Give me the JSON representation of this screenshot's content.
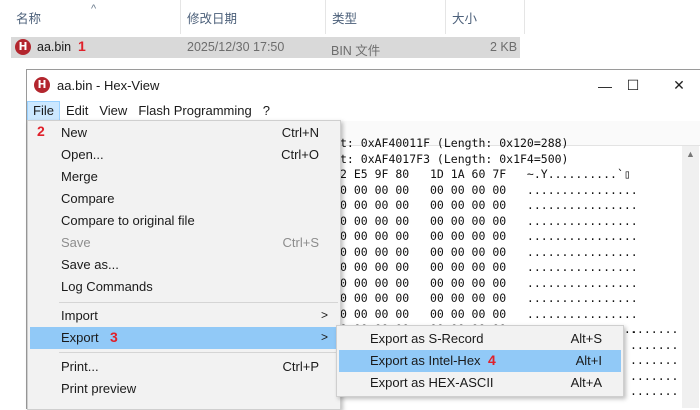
{
  "explorer": {
    "headers": {
      "name": "名称",
      "modified": "修改日期",
      "type": "类型",
      "size": "大小"
    },
    "file": {
      "icon": "hexview-file-icon",
      "name": "aa.bin",
      "step": "1",
      "date": "2025/12/30 17:50",
      "type": "BIN 文件",
      "size": "2 KB"
    }
  },
  "window": {
    "title": "aa.bin - Hex-View",
    "controls": {
      "minimize": "—",
      "maximize": "☐",
      "close": "✕"
    }
  },
  "menubar": [
    "File",
    "Edit",
    "View",
    "Flash Programming",
    "?"
  ],
  "file_menu": {
    "step": "2",
    "items": [
      {
        "label": "New",
        "shortcut": "Ctrl+N"
      },
      {
        "label": "Open...",
        "shortcut": "Ctrl+O"
      },
      {
        "label": "Merge",
        "shortcut": ""
      },
      {
        "label": "Compare",
        "shortcut": ""
      },
      {
        "label": "Compare to original file",
        "shortcut": ""
      },
      {
        "label": "Save",
        "shortcut": "Ctrl+S"
      },
      {
        "label": "Save as...",
        "shortcut": ""
      },
      {
        "label": "Log Commands",
        "shortcut": ""
      },
      {
        "label": "Import",
        "shortcut": ""
      },
      {
        "label": "Export",
        "shortcut": "",
        "step": "3"
      },
      {
        "label": "Print...",
        "shortcut": "Ctrl+P"
      },
      {
        "label": "Print preview",
        "shortcut": ""
      }
    ]
  },
  "export_menu": {
    "items": [
      {
        "label": "Export as S-Record",
        "shortcut": "Alt+S"
      },
      {
        "label": "Export as Intel-Hex",
        "shortcut": "Alt+I",
        "step": "4"
      },
      {
        "label": "Export as HEX-ASCII",
        "shortcut": "Alt+A"
      }
    ]
  },
  "hex": {
    "lines": [
      "t: 0xAF40011F (Length: 0x120=288)",
      "t: 0xAF4017F3 (Length: 0x1F4=500)",
      "2 E5 9F 80   1D 1A 60 7F   ~.Y..........`▯",
      "0 00 00 00   00 00 00 00   ................",
      "0 00 00 00   00 00 00 00   ................",
      "0 00 00 00   00 00 00 00   ................",
      "0 00 00 00   00 00 00 00   ................",
      "0 00 00 00   00 00 00 00   ................",
      "0 00 00 00   00 00 00 00   ................",
      "0 00 00 00   00 00 00 00   ................",
      "0 00 00 00   00 00 00 00   ................",
      "0 00 00 00   00 00 00 00   ................",
      "0 00 00 00   00 00 00 00   ................",
      "",
      "",
      "",
      "",
      ""
    ],
    "tail_lines": [
      ".......",
      ".......",
      ".......",
      ".......",
      "......."
    ]
  },
  "colors": {
    "highlight": "#91c9f7",
    "menu_active": "#cce8ff",
    "step_marker": "#e0202a",
    "icon_red": "#b3262e"
  }
}
